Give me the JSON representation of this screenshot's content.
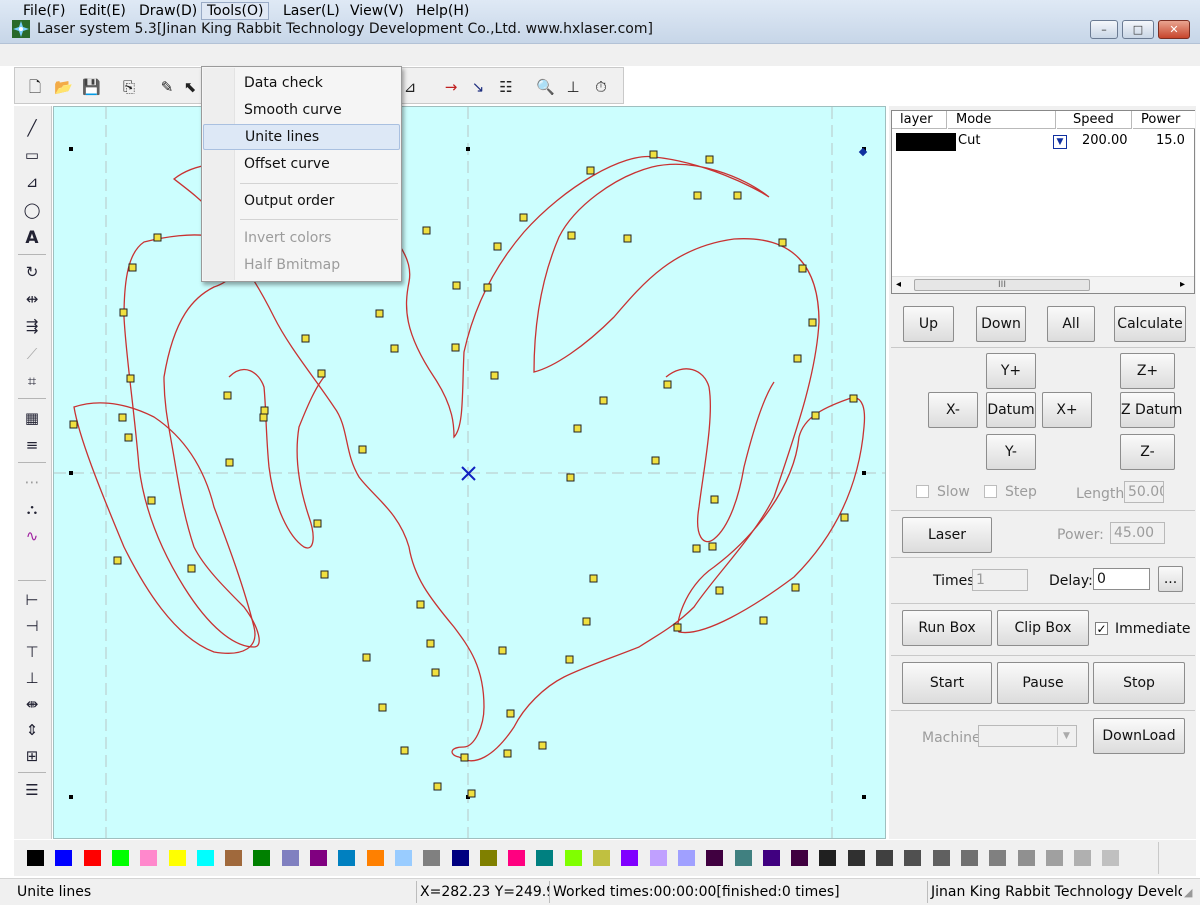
{
  "window": {
    "title": "Laser system 5.3[Jinan King Rabbit Technology Development Co.,Ltd. www.hxlaser.com]",
    "controls": {
      "minimize": "–",
      "maximize": "□",
      "close": "✕"
    }
  },
  "menubar": {
    "items": [
      "File(F)",
      "Edit(E)",
      "Draw(D)",
      "Tools(O)",
      "Laser(L)",
      "View(V)",
      "Help(H)"
    ],
    "open_menu": "Tools(O)"
  },
  "tools_menu": {
    "items": [
      {
        "label": "Data check",
        "state": "normal"
      },
      {
        "label": "Smooth curve",
        "state": "normal"
      },
      {
        "label": "Unite lines",
        "state": "highlighted"
      },
      {
        "label": "Offset curve",
        "state": "normal"
      },
      {
        "label": "Output order",
        "state": "normal"
      },
      {
        "label": "Invert colors",
        "state": "disabled"
      },
      {
        "label": "Half Bmitmap",
        "state": "disabled"
      }
    ]
  },
  "toolbar_icons": [
    "new-file-icon",
    "open-folder-icon",
    "save-icon",
    "import-icon",
    "brush-icon",
    "select-arrow-icon",
    "polyline-icon",
    "laser-arrow-icon",
    "node-icon",
    "array-icon",
    "preview-icon",
    "ruler-icon",
    "timer-icon"
  ],
  "left_tools": [
    "line-tool-icon",
    "rectangle-tool-icon",
    "polyline-tool-icon",
    "ellipse-tool-icon",
    "text-tool-icon",
    "rotate-icon",
    "mirror-icon",
    "align-icon",
    "node-edit-icon",
    "crop-icon",
    "grid-icon",
    "hatch-icon",
    "dots-icon",
    "stamp-icon",
    "curve-icon",
    "align-left-icon",
    "align-right-icon",
    "align-top-icon",
    "align-bottom-icon",
    "center-h-icon",
    "center-v-icon",
    "center-both-icon",
    "layers-icon"
  ],
  "layer_table": {
    "headers": [
      "layer",
      "Mode",
      "Speed",
      "Power"
    ],
    "rows": [
      {
        "color": "#000000",
        "mode": "Cut",
        "speed": "200.00",
        "power": "15.0"
      }
    ],
    "scroll_grip": "III"
  },
  "layer_buttons": {
    "up": "Up",
    "down": "Down",
    "all": "All",
    "calculate": "Calculate"
  },
  "jog": {
    "y_plus": "Y+",
    "x_minus": "X-",
    "datum": "Datum",
    "x_plus": "X+",
    "y_minus": "Y-",
    "z_plus": "Z+",
    "z_datum": "Z Datum",
    "z_minus": "Z-",
    "slow": "Slow",
    "step": "Step",
    "length_label": "Length:",
    "length_value": "50.00"
  },
  "laser": {
    "button": "Laser",
    "power_label": "Power:",
    "power_value": "45.00"
  },
  "timing": {
    "times_label": "Times:",
    "times_value": "1",
    "delay_label": "Delay:",
    "delay_value": "0",
    "more": "..."
  },
  "box": {
    "run_box": "Run Box",
    "clip_box": "Clip Box",
    "immediate": "Immediate",
    "immediate_checked": true
  },
  "run": {
    "start": "Start",
    "pause": "Pause",
    "stop": "Stop"
  },
  "machine": {
    "label": "Machine:",
    "value": "",
    "download": "DownLoad"
  },
  "palette": [
    "#000000",
    "#0000ff",
    "#ff0000",
    "#00ff00",
    "#ff88cc",
    "#ffff00",
    "#00ffff",
    "#a0693c",
    "#008000",
    "#8080c0",
    "#800080",
    "#0080c0",
    "#ff8000",
    "#99ccff",
    "#808080",
    "#000080",
    "#808000",
    "#ff0080",
    "#008080",
    "#80ff00",
    "#c0c040",
    "#8000ff",
    "#c0a0ff",
    "#a0a0ff",
    "#400040",
    "#408080",
    "#400080",
    "#400040",
    "#202020",
    "#303030",
    "#404040",
    "#505050",
    "#606060",
    "#707070",
    "#808080",
    "#909090",
    "#a0a0a0",
    "#b0b0b0",
    "#c0c0c0"
  ],
  "statusbar": {
    "action": "Unite lines",
    "coords": "X=282.23 Y=249.92",
    "worked": "Worked times:00:00:00[finished:0 times]",
    "company": "Jinan King Rabbit Technology Develop"
  }
}
